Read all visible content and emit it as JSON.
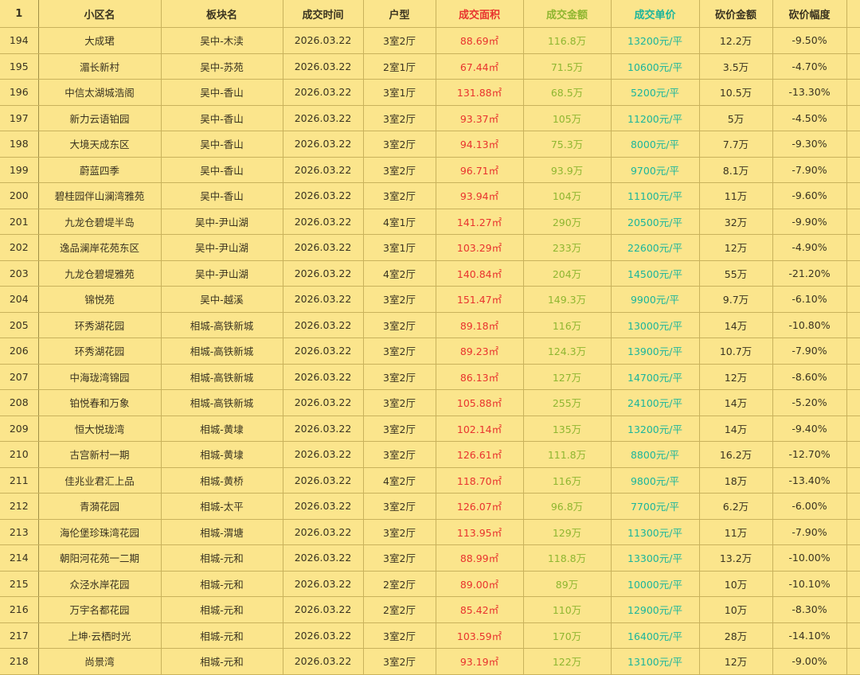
{
  "header": {
    "row_index": "1",
    "cols": [
      "小区名",
      "板块名",
      "成交时间",
      "户型",
      "成交面积",
      "成交金额",
      "成交单价",
      "砍价金额",
      "砍价幅度"
    ]
  },
  "rows": [
    {
      "n": "194",
      "name": "大成珺",
      "block": "吴中-木渎",
      "date": "2026.03.22",
      "type": "3室2厅",
      "area": "88.69㎡",
      "amount": "116.8万",
      "unit": "13200元/平",
      "cut": "12.2万",
      "pct": "-9.50%"
    },
    {
      "n": "195",
      "name": "湄长新村",
      "block": "吴中-苏苑",
      "date": "2026.03.22",
      "type": "2室1厅",
      "area": "67.44㎡",
      "amount": "71.5万",
      "unit": "10600元/平",
      "cut": "3.5万",
      "pct": "-4.70%"
    },
    {
      "n": "196",
      "name": "中信太湖城浩阁",
      "block": "吴中-香山",
      "date": "2026.03.22",
      "type": "3室1厅",
      "area": "131.88㎡",
      "amount": "68.5万",
      "unit": "5200元/平",
      "cut": "10.5万",
      "pct": "-13.30%"
    },
    {
      "n": "197",
      "name": "新力云语铂园",
      "block": "吴中-香山",
      "date": "2026.03.22",
      "type": "3室2厅",
      "area": "93.37㎡",
      "amount": "105万",
      "unit": "11200元/平",
      "cut": "5万",
      "pct": "-4.50%"
    },
    {
      "n": "198",
      "name": "大境天成东区",
      "block": "吴中-香山",
      "date": "2026.03.22",
      "type": "3室2厅",
      "area": "94.13㎡",
      "amount": "75.3万",
      "unit": "8000元/平",
      "cut": "7.7万",
      "pct": "-9.30%"
    },
    {
      "n": "199",
      "name": "蔚蓝四季",
      "block": "吴中-香山",
      "date": "2026.03.22",
      "type": "3室2厅",
      "area": "96.71㎡",
      "amount": "93.9万",
      "unit": "9700元/平",
      "cut": "8.1万",
      "pct": "-7.90%"
    },
    {
      "n": "200",
      "name": "碧桂园伴山澜湾雅苑",
      "block": "吴中-香山",
      "date": "2026.03.22",
      "type": "3室2厅",
      "area": "93.94㎡",
      "amount": "104万",
      "unit": "11100元/平",
      "cut": "11万",
      "pct": "-9.60%"
    },
    {
      "n": "201",
      "name": "九龙仓碧堤半岛",
      "block": "吴中-尹山湖",
      "date": "2026.03.22",
      "type": "4室1厅",
      "area": "141.27㎡",
      "amount": "290万",
      "unit": "20500元/平",
      "cut": "32万",
      "pct": "-9.90%"
    },
    {
      "n": "202",
      "name": "逸品澜岸花苑东区",
      "block": "吴中-尹山湖",
      "date": "2026.03.22",
      "type": "3室1厅",
      "area": "103.29㎡",
      "amount": "233万",
      "unit": "22600元/平",
      "cut": "12万",
      "pct": "-4.90%"
    },
    {
      "n": "203",
      "name": "九龙仓碧堤雅苑",
      "block": "吴中-尹山湖",
      "date": "2026.03.22",
      "type": "4室2厅",
      "area": "140.84㎡",
      "amount": "204万",
      "unit": "14500元/平",
      "cut": "55万",
      "pct": "-21.20%"
    },
    {
      "n": "204",
      "name": "锦悦苑",
      "block": "吴中-越溪",
      "date": "2026.03.22",
      "type": "3室2厅",
      "area": "151.47㎡",
      "amount": "149.3万",
      "unit": "9900元/平",
      "cut": "9.7万",
      "pct": "-6.10%"
    },
    {
      "n": "205",
      "name": "环秀湖花园",
      "block": "相城-高铁新城",
      "date": "2026.03.22",
      "type": "3室2厅",
      "area": "89.18㎡",
      "amount": "116万",
      "unit": "13000元/平",
      "cut": "14万",
      "pct": "-10.80%"
    },
    {
      "n": "206",
      "name": "环秀湖花园",
      "block": "相城-高铁新城",
      "date": "2026.03.22",
      "type": "3室2厅",
      "area": "89.23㎡",
      "amount": "124.3万",
      "unit": "13900元/平",
      "cut": "10.7万",
      "pct": "-7.90%"
    },
    {
      "n": "207",
      "name": "中海珑湾锦园",
      "block": "相城-高铁新城",
      "date": "2026.03.22",
      "type": "3室2厅",
      "area": "86.13㎡",
      "amount": "127万",
      "unit": "14700元/平",
      "cut": "12万",
      "pct": "-8.60%"
    },
    {
      "n": "208",
      "name": "铂悦春和万象",
      "block": "相城-高铁新城",
      "date": "2026.03.22",
      "type": "3室2厅",
      "area": "105.88㎡",
      "amount": "255万",
      "unit": "24100元/平",
      "cut": "14万",
      "pct": "-5.20%"
    },
    {
      "n": "209",
      "name": "恒大悦珑湾",
      "block": "相城-黄埭",
      "date": "2026.03.22",
      "type": "3室2厅",
      "area": "102.14㎡",
      "amount": "135万",
      "unit": "13200元/平",
      "cut": "14万",
      "pct": "-9.40%"
    },
    {
      "n": "210",
      "name": "古宫新村一期",
      "block": "相城-黄埭",
      "date": "2026.03.22",
      "type": "3室2厅",
      "area": "126.61㎡",
      "amount": "111.8万",
      "unit": "8800元/平",
      "cut": "16.2万",
      "pct": "-12.70%"
    },
    {
      "n": "211",
      "name": "佳兆业君汇上品",
      "block": "相城-黄桥",
      "date": "2026.03.22",
      "type": "4室2厅",
      "area": "118.70㎡",
      "amount": "116万",
      "unit": "9800元/平",
      "cut": "18万",
      "pct": "-13.40%"
    },
    {
      "n": "212",
      "name": "青漪花园",
      "block": "相城-太平",
      "date": "2026.03.22",
      "type": "3室2厅",
      "area": "126.07㎡",
      "amount": "96.8万",
      "unit": "7700元/平",
      "cut": "6.2万",
      "pct": "-6.00%"
    },
    {
      "n": "213",
      "name": "海伦堡珍珠湾花园",
      "block": "相城-渭塘",
      "date": "2026.03.22",
      "type": "3室2厅",
      "area": "113.95㎡",
      "amount": "129万",
      "unit": "11300元/平",
      "cut": "11万",
      "pct": "-7.90%"
    },
    {
      "n": "214",
      "name": "朝阳河花苑一二期",
      "block": "相城-元和",
      "date": "2026.03.22",
      "type": "3室2厅",
      "area": "88.99㎡",
      "amount": "118.8万",
      "unit": "13300元/平",
      "cut": "13.2万",
      "pct": "-10.00%"
    },
    {
      "n": "215",
      "name": "众泾水岸花园",
      "block": "相城-元和",
      "date": "2026.03.22",
      "type": "2室2厅",
      "area": "89.00㎡",
      "amount": "89万",
      "unit": "10000元/平",
      "cut": "10万",
      "pct": "-10.10%"
    },
    {
      "n": "216",
      "name": "万宇名都花园",
      "block": "相城-元和",
      "date": "2026.03.22",
      "type": "2室2厅",
      "area": "85.42㎡",
      "amount": "110万",
      "unit": "12900元/平",
      "cut": "10万",
      "pct": "-8.30%"
    },
    {
      "n": "217",
      "name": "上坤·云栖时光",
      "block": "相城-元和",
      "date": "2026.03.22",
      "type": "3室2厅",
      "area": "103.59㎡",
      "amount": "170万",
      "unit": "16400元/平",
      "cut": "28万",
      "pct": "-14.10%"
    },
    {
      "n": "218",
      "name": "尚景湾",
      "block": "相城-元和",
      "date": "2026.03.22",
      "type": "3室2厅",
      "area": "93.19㎡",
      "amount": "122万",
      "unit": "13100元/平",
      "cut": "12万",
      "pct": "-9.00%"
    }
  ],
  "colors": {
    "background": "#fbe58c",
    "grid": "#c9b25c",
    "area_red": "#e8332e",
    "amount_yellowgreen": "#8fb630",
    "unit_teal": "#1bb59c"
  }
}
